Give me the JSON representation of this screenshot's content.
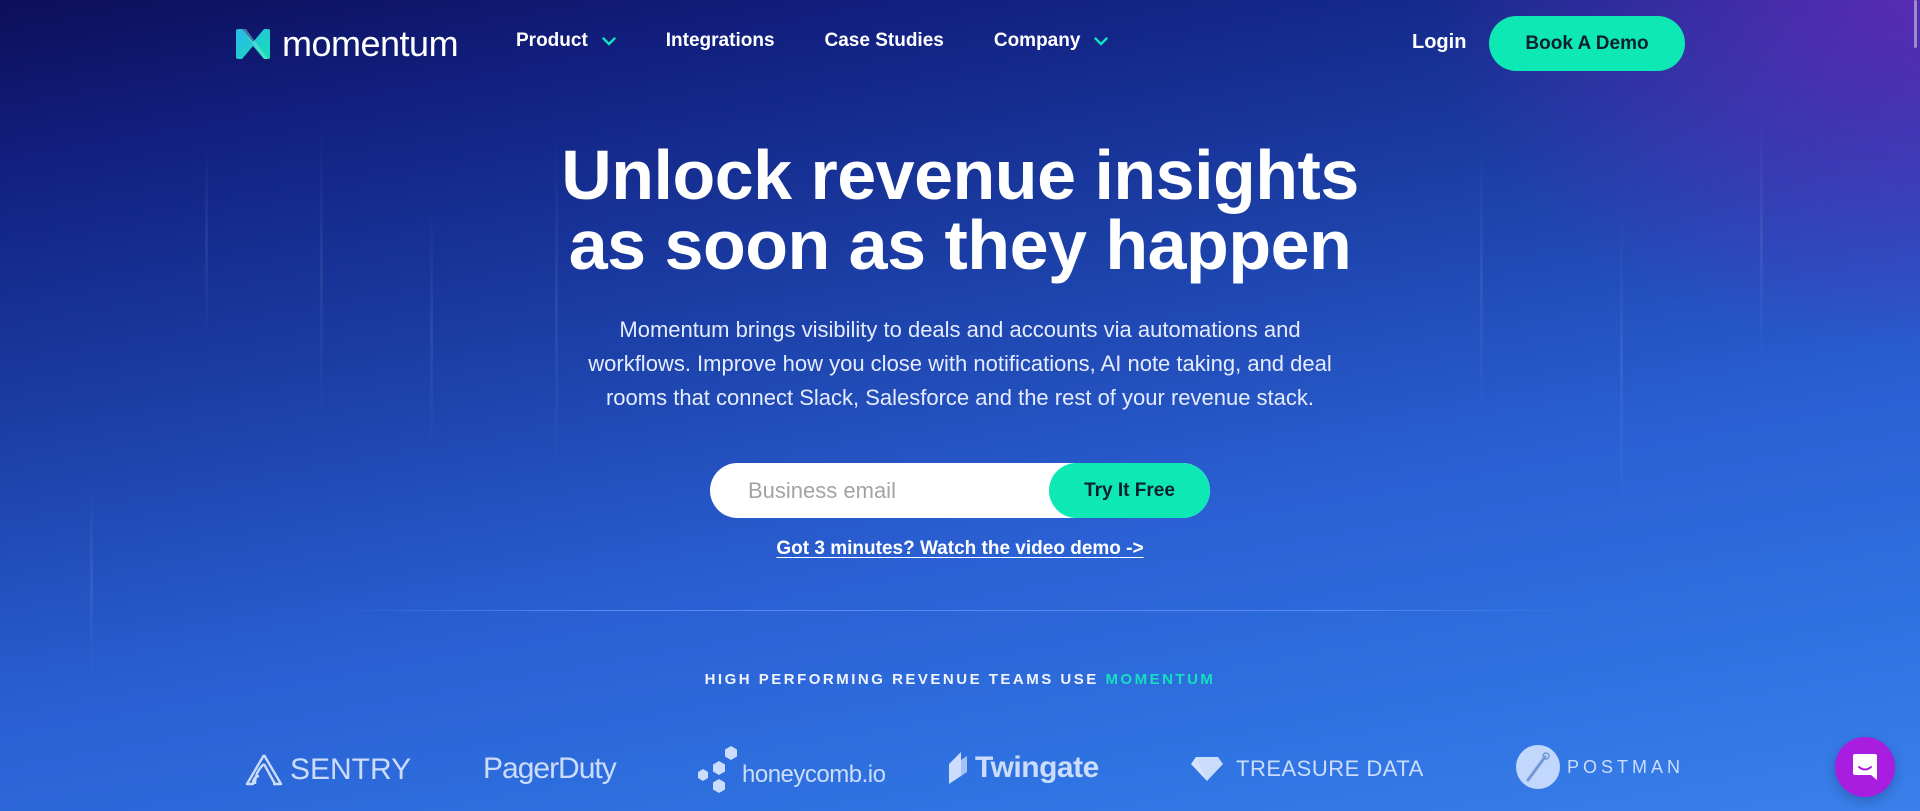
{
  "brand": {
    "name": "momentum",
    "accent_color": "#0ee8b4",
    "chat_color": "#a81de0"
  },
  "nav": {
    "items": [
      {
        "label": "Product",
        "has_dropdown": true
      },
      {
        "label": "Integrations",
        "has_dropdown": false
      },
      {
        "label": "Case Studies",
        "has_dropdown": false
      },
      {
        "label": "Company",
        "has_dropdown": true
      }
    ],
    "login_label": "Login",
    "cta_label": "Book A Demo"
  },
  "hero": {
    "headline_line1": "Unlock revenue insights",
    "headline_line2": "as soon as they happen",
    "subtext_line1": "Momentum brings visibility to deals and accounts via automations and",
    "subtext_line2": "workflows. Improve how you close with notifications, AI note taking, and deal",
    "subtext_line3": "rooms that connect Slack, Salesforce and the rest of your revenue stack.",
    "email_placeholder": "Business email",
    "email_value": "",
    "try_label": "Try It Free",
    "video_link_label": "Got 3 minutes? Watch the video demo ->"
  },
  "social_proof": {
    "label_prefix": "HIGH PERFORMING REVENUE TEAMS USE",
    "label_accent": "MOMENTUM",
    "customers": [
      {
        "name": "SENTRY",
        "icon": "sentry-logo-icon"
      },
      {
        "name": "PagerDuty",
        "icon": "pagerduty-logo-icon"
      },
      {
        "name": "honeycomb.io",
        "icon": "honeycomb-hexagon-icon"
      },
      {
        "name": "Twingate",
        "icon": "twingate-logo-icon"
      },
      {
        "name": "TREASURE DATA",
        "icon": "diamond-icon"
      },
      {
        "name": "POSTMAN",
        "icon": "postman-logo-icon"
      }
    ]
  },
  "chat_widget": {
    "icon": "chat-bubble-icon"
  }
}
